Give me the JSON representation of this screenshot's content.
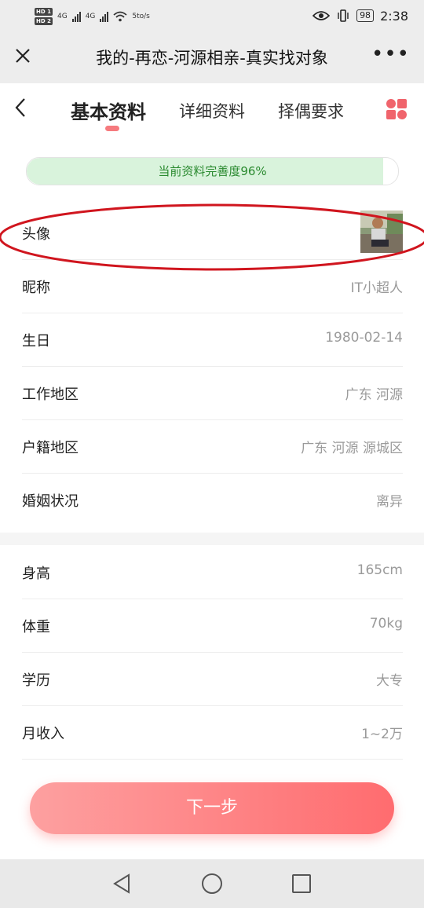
{
  "status_bar": {
    "hd1": "HD 1",
    "hd2": "HD 2",
    "net1": "4G",
    "net2": "4G",
    "speed": "5to/s",
    "battery": "98",
    "time": "2:38"
  },
  "title_bar": {
    "close_icon": "close-icon",
    "title": "我的-再恋-河源相亲-真实找对象",
    "more_label": "•••"
  },
  "tabs": [
    {
      "label": "基本资料",
      "active": true
    },
    {
      "label": "详细资料",
      "active": false
    },
    {
      "label": "择偶要求",
      "active": false
    }
  ],
  "progress": {
    "label": "当前资料完善度96%",
    "percent": 96
  },
  "section1": [
    {
      "label": "头像",
      "value": "",
      "type": "avatar"
    },
    {
      "label": "昵称",
      "value": "IT小超人"
    },
    {
      "label": "生日",
      "value": "1980-02-14"
    },
    {
      "label": "工作地区",
      "value": "广东 河源"
    },
    {
      "label": "户籍地区",
      "value": "广东 河源 源城区"
    },
    {
      "label": "婚姻状况",
      "value": "离异"
    }
  ],
  "section2": [
    {
      "label": "身高",
      "value": "165cm"
    },
    {
      "label": "体重",
      "value": "70kg"
    },
    {
      "label": "学历",
      "value": "大专"
    },
    {
      "label": "月收入",
      "value": "1~2万"
    }
  ],
  "next_button": {
    "label": "下一步"
  },
  "colors": {
    "accent": "#f0646c",
    "progress_fill": "#d9f3dc",
    "progress_text": "#2a8a2f",
    "annotation": "#d0151e"
  }
}
